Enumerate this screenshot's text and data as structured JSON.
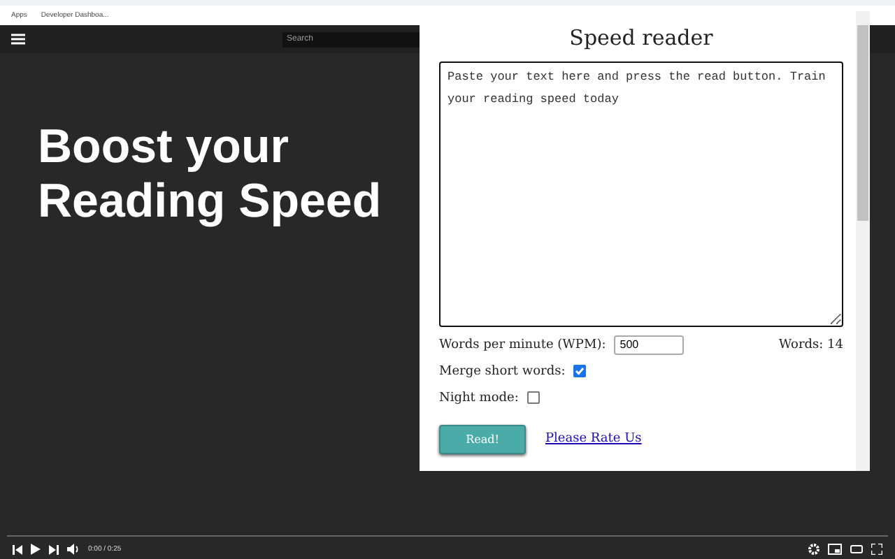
{
  "browser": {
    "bookmarks": [
      {
        "label": "Apps"
      },
      {
        "label": "Developer Dashboa..."
      }
    ]
  },
  "video_page": {
    "search": {
      "placeholder": "Search"
    },
    "headline": [
      "Boost your",
      "Reading Speed"
    ],
    "player": {
      "time": "0:00 / 0:25"
    }
  },
  "popup": {
    "title": "Speed reader",
    "text": "Paste your text here and press the read button. Train your reading speed today",
    "wpm_label": "Words per minute (WPM):",
    "wpm_value": "500",
    "word_count": "Words: 14",
    "options": [
      {
        "label": "Merge short words:",
        "checked": true
      },
      {
        "label": "Night mode:",
        "checked": false
      }
    ],
    "read_button": "Read!",
    "rate_link": "Please Rate Us"
  }
}
